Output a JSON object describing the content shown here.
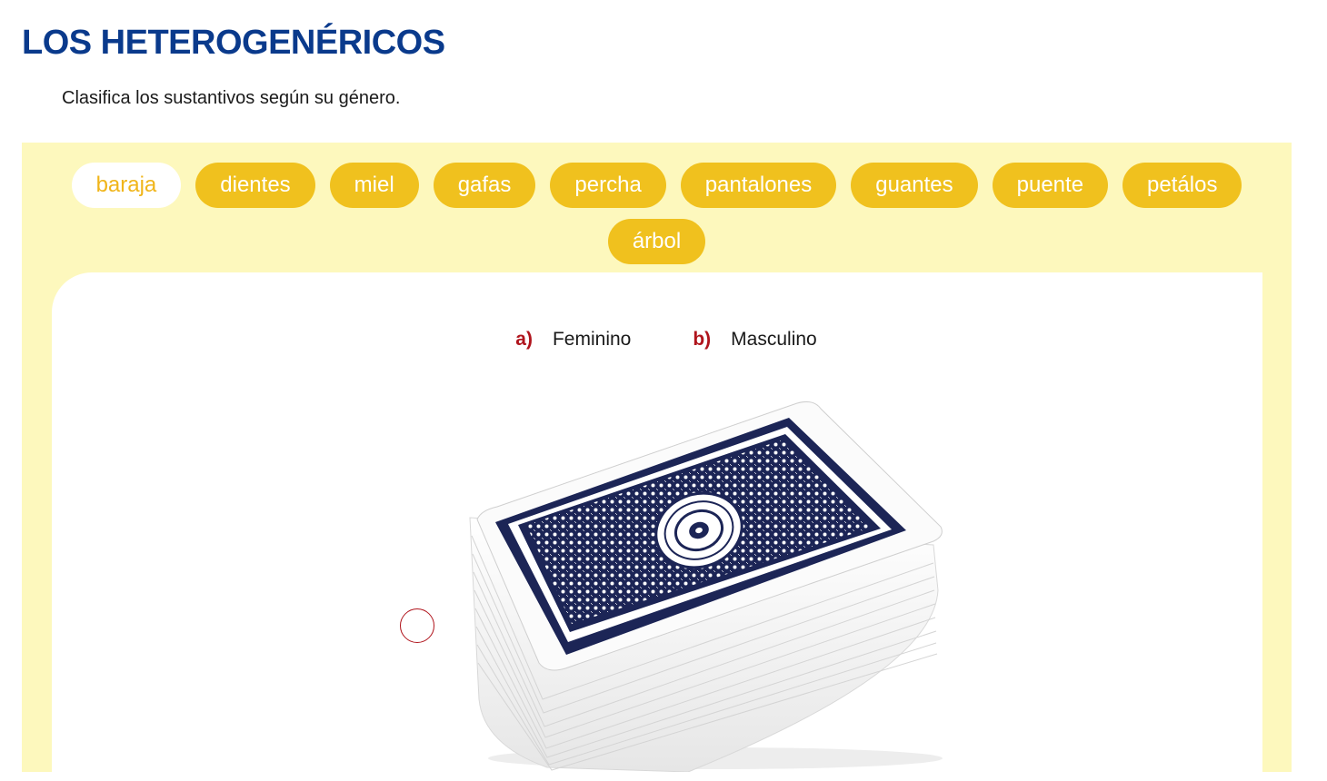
{
  "header": {
    "title": "LOS HETEROGENÉRICOS",
    "instruction": "Clasifica los sustantivos según su género."
  },
  "word_bank": [
    {
      "label": "baraja",
      "selected": true
    },
    {
      "label": "dientes",
      "selected": false
    },
    {
      "label": "miel",
      "selected": false
    },
    {
      "label": "gafas",
      "selected": false
    },
    {
      "label": "percha",
      "selected": false
    },
    {
      "label": "pantalones",
      "selected": false
    },
    {
      "label": "guantes",
      "selected": false
    },
    {
      "label": "puente",
      "selected": false
    },
    {
      "label": "petálos",
      "selected": false
    },
    {
      "label": "árbol",
      "selected": false
    }
  ],
  "options": [
    {
      "letter": "a)",
      "text": "Feminino"
    },
    {
      "letter": "b)",
      "text": "Masculino"
    }
  ],
  "image": {
    "subject": "deck-of-playing-cards",
    "card_back_color": "#1c2556"
  },
  "colors": {
    "title": "#0a3a8c",
    "panel_bg": "#fdf8bd",
    "chip_bg": "#f0c11e",
    "chip_text": "#ffffff",
    "chip_selected_bg": "#ffffff",
    "chip_selected_text": "#f0b51a",
    "option_letter": "#b0141c"
  }
}
